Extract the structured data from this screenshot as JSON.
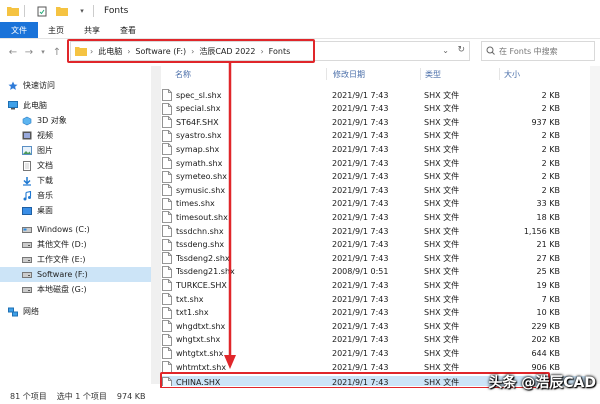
{
  "window": {
    "title": "Fonts"
  },
  "ribbon": {
    "tabs": [
      "文件",
      "主页",
      "共享",
      "查看"
    ]
  },
  "address": {
    "crumbs": [
      "此电脑",
      "Software (F:)",
      "浩辰CAD 2022",
      "Fonts"
    ],
    "search_placeholder": "在 Fonts 中搜索"
  },
  "columns": {
    "name": "名称",
    "date": "修改日期",
    "type": "类型",
    "size": "大小"
  },
  "sidebar": {
    "items": [
      {
        "label": "快速访问",
        "icon": "star-icon"
      },
      {
        "label": "此电脑",
        "icon": "computer-icon"
      },
      {
        "label": "3D 对象",
        "icon": "cube-icon"
      },
      {
        "label": "视频",
        "icon": "video-icon"
      },
      {
        "label": "图片",
        "icon": "picture-icon"
      },
      {
        "label": "文档",
        "icon": "document-icon"
      },
      {
        "label": "下载",
        "icon": "download-icon"
      },
      {
        "label": "音乐",
        "icon": "music-icon"
      },
      {
        "label": "桌面",
        "icon": "desktop-icon"
      },
      {
        "label": "Windows (C:)",
        "icon": "drive-icon"
      },
      {
        "label": "其他文件 (D:)",
        "icon": "drive-icon"
      },
      {
        "label": "工作文件 (E:)",
        "icon": "drive-icon"
      },
      {
        "label": "Software (F:)",
        "icon": "drive-icon"
      },
      {
        "label": "本地磁盘 (G:)",
        "icon": "drive-icon"
      },
      {
        "label": "网络",
        "icon": "network-icon"
      }
    ]
  },
  "files": [
    {
      "name": "spec_sl.shx",
      "date": "2021/9/1 7:43",
      "type": "SHX 文件",
      "size": "2 KB"
    },
    {
      "name": "special.shx",
      "date": "2021/9/1 7:43",
      "type": "SHX 文件",
      "size": "2 KB"
    },
    {
      "name": "ST64F.SHX",
      "date": "2021/9/1 7:43",
      "type": "SHX 文件",
      "size": "937 KB"
    },
    {
      "name": "syastro.shx",
      "date": "2021/9/1 7:43",
      "type": "SHX 文件",
      "size": "2 KB"
    },
    {
      "name": "symap.shx",
      "date": "2021/9/1 7:43",
      "type": "SHX 文件",
      "size": "2 KB"
    },
    {
      "name": "symath.shx",
      "date": "2021/9/1 7:43",
      "type": "SHX 文件",
      "size": "2 KB"
    },
    {
      "name": "symeteo.shx",
      "date": "2021/9/1 7:43",
      "type": "SHX 文件",
      "size": "2 KB"
    },
    {
      "name": "symusic.shx",
      "date": "2021/9/1 7:43",
      "type": "SHX 文件",
      "size": "2 KB"
    },
    {
      "name": "times.shx",
      "date": "2021/9/1 7:43",
      "type": "SHX 文件",
      "size": "33 KB"
    },
    {
      "name": "timesout.shx",
      "date": "2021/9/1 7:43",
      "type": "SHX 文件",
      "size": "18 KB"
    },
    {
      "name": "tssdchn.shx",
      "date": "2021/9/1 7:43",
      "type": "SHX 文件",
      "size": "1,156 KB"
    },
    {
      "name": "tssdeng.shx",
      "date": "2021/9/1 7:43",
      "type": "SHX 文件",
      "size": "21 KB"
    },
    {
      "name": "Tssdeng2.shx",
      "date": "2021/9/1 7:43",
      "type": "SHX 文件",
      "size": "27 KB"
    },
    {
      "name": "Tssdeng21.shx",
      "date": "2008/9/1 0:51",
      "type": "SHX 文件",
      "size": "25 KB"
    },
    {
      "name": "TURKCE.SHX",
      "date": "2021/9/1 7:43",
      "type": "SHX 文件",
      "size": "19 KB"
    },
    {
      "name": "txt.shx",
      "date": "2021/9/1 7:43",
      "type": "SHX 文件",
      "size": "7 KB"
    },
    {
      "name": "txt1.shx",
      "date": "2021/9/1 7:43",
      "type": "SHX 文件",
      "size": "10 KB"
    },
    {
      "name": "whgdtxt.shx",
      "date": "2021/9/1 7:43",
      "type": "SHX 文件",
      "size": "229 KB"
    },
    {
      "name": "whgtxt.shx",
      "date": "2021/9/1 7:43",
      "type": "SHX 文件",
      "size": "202 KB"
    },
    {
      "name": "whtgtxt.shx",
      "date": "2021/9/1 7:43",
      "type": "SHX 文件",
      "size": "644 KB"
    },
    {
      "name": "whtmtxt.shx",
      "date": "2021/9/1 7:43",
      "type": "SHX 文件",
      "size": "906 KB"
    },
    {
      "name": "CHINA.SHX",
      "date": "2021/9/1 7:43",
      "type": "SHX 文件",
      "size": ""
    }
  ],
  "status": {
    "count": "81 个项目",
    "selected": "选中 1 个项目",
    "size": "974 KB"
  },
  "watermark": "头条 @浩辰CAD",
  "colors": {
    "accent": "#1a73d9",
    "highlight": "#e0262a",
    "selection": "#cce4f7"
  }
}
